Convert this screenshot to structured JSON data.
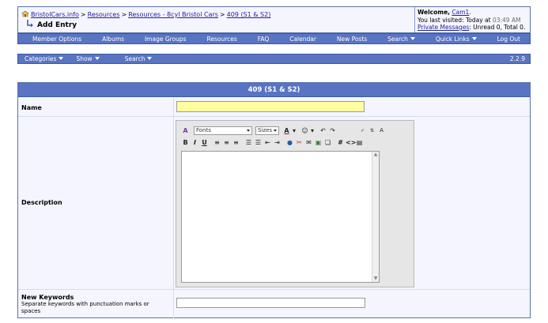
{
  "breadcrumb": {
    "items": [
      "BristolCars.info",
      "Resources",
      "Resources - 8cyl Bristol Cars",
      "409 (S1 & S2)"
    ],
    "separator": ">"
  },
  "page_title": "Add Entry",
  "welcome": {
    "prefix": "Welcome,",
    "username": "Cam1",
    "suffix": ".",
    "last_visit_label": "You last visited: Today at",
    "last_visit_time": "03:49 AM",
    "pm_link": "Private Messages",
    "pm_status": ": Unread 0, Total 0."
  },
  "nav": {
    "items": [
      "Member Options",
      "Albums",
      "Image Groups",
      "Resources",
      "FAQ",
      "Calendar",
      "New Posts",
      "Search",
      "Quick Links",
      "Log Out"
    ]
  },
  "subnav": {
    "categories": "Categories",
    "show": "Show",
    "search": "Search",
    "version": "2.2.9"
  },
  "form": {
    "header": "409 (S1 & S2)",
    "name_label": "Name",
    "name_value": "",
    "description_label": "Description",
    "keywords_label": "New Keywords",
    "keywords_hint": "Separate keywords with punctuation marks or spaces",
    "keywords_value": ""
  },
  "editor": {
    "font_select": "Fonts",
    "size_select": "Sizes"
  },
  "colors": {
    "nav_bg": "#5874c2",
    "panel_bg": "#f5f5ff",
    "name_input_bg": "#ffffa0",
    "link": "#22229c"
  }
}
